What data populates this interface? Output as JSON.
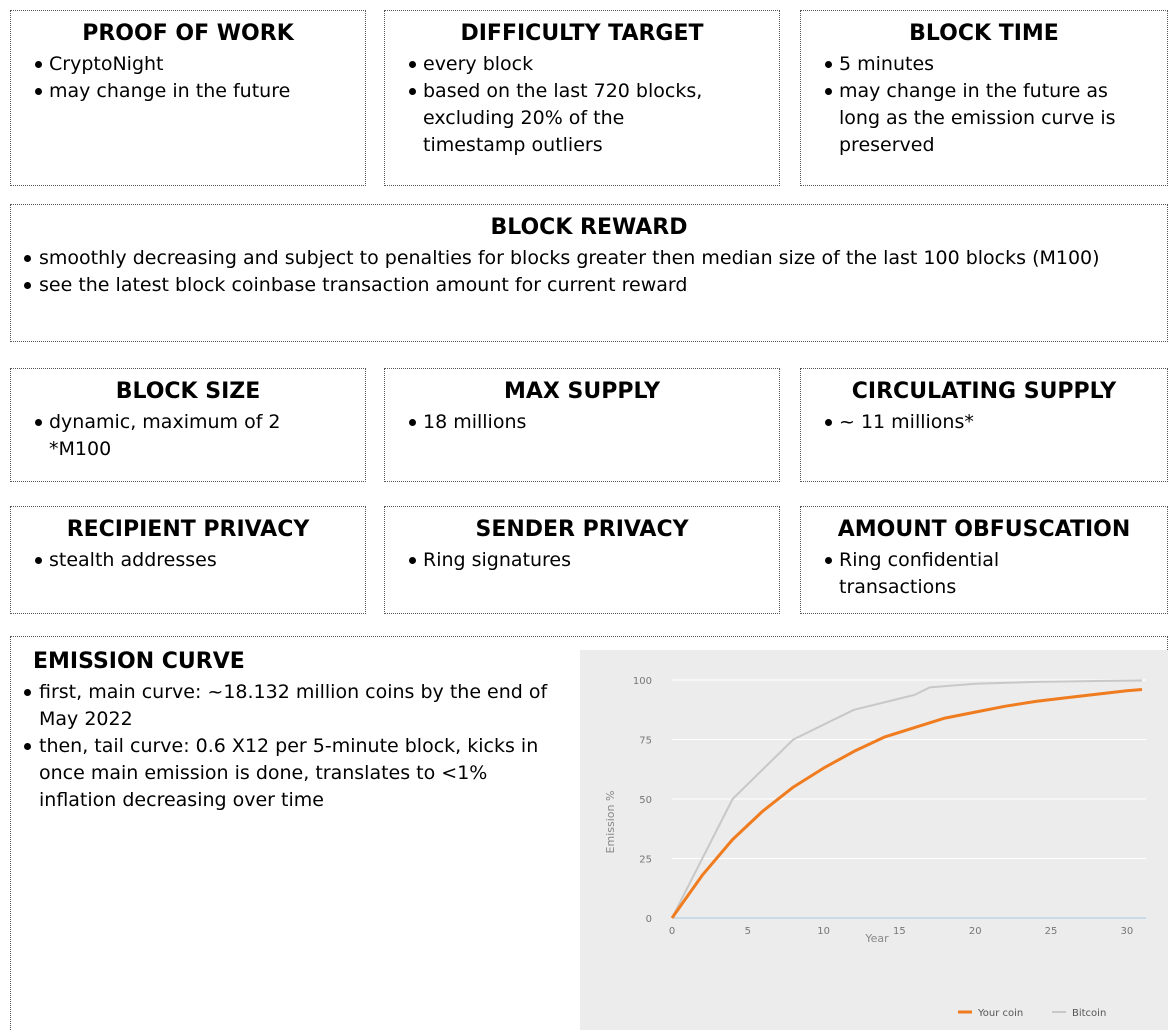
{
  "row1": [
    {
      "title": "PROOF OF WORK",
      "items": [
        "CryptoNight",
        "may change in the future"
      ]
    },
    {
      "title": "DIFFICULTY TARGET",
      "items": [
        "every block",
        "based on the last 720 blocks, excluding 20% of the timestamp outliers"
      ]
    },
    {
      "title": "BLOCK TIME",
      "items": [
        "5 minutes",
        "may change in the future as long as the emission curve is preserved"
      ]
    }
  ],
  "reward": {
    "title": "BLOCK REWARD",
    "items": [
      "smoothly decreasing and subject to penalties for blocks greater then median size of the last 100 blocks (M100)",
      "see the latest block coinbase transaction amount for current reward"
    ]
  },
  "row3": [
    {
      "title": "BLOCK SIZE",
      "items": [
        "dynamic, maximum of 2 *M100"
      ]
    },
    {
      "title": "MAX SUPPLY",
      "items": [
        "18 millions"
      ]
    },
    {
      "title": "CIRCULATING SUPPLY",
      "items": [
        "~ 11 millions*"
      ]
    }
  ],
  "row4": [
    {
      "title": "RECIPIENT PRIVACY",
      "items": [
        "stealth addresses"
      ]
    },
    {
      "title": "SENDER PRIVACY",
      "items": [
        "Ring signatures"
      ]
    },
    {
      "title": "AMOUNT OBFUSCATION",
      "items": [
        "Ring confidential transactions"
      ]
    }
  ],
  "emission": {
    "title": "EMISSION CURVE",
    "items": [
      "first, main curve: ~18.132 million coins by the end of May 2022",
      "then, tail curve: 0.6 X12 per 5-minute block, kicks in once main emission is done, translates to <1%  inflation decreasing over time"
    ]
  },
  "chart_data": {
    "type": "line",
    "xlabel": "Year",
    "ylabel": "Emission %",
    "xlim": [
      0,
      31
    ],
    "ylim": [
      0,
      100
    ],
    "xticks": [
      0,
      5,
      10,
      15,
      20,
      25,
      30
    ],
    "yticks": [
      0,
      25,
      50,
      75,
      100
    ],
    "grid": true,
    "legend": "bottom-right",
    "series": [
      {
        "name": "Your coin",
        "color": "#f07c20",
        "x": [
          0,
          2,
          4,
          6,
          8,
          10,
          12,
          14,
          16,
          18,
          20,
          22,
          24,
          26,
          28,
          30,
          31
        ],
        "y": [
          0,
          18,
          33,
          45,
          55,
          63,
          70,
          76,
          80,
          84,
          86.5,
          89,
          91,
          92.5,
          94,
          95.5,
          96
        ]
      },
      {
        "name": "Bitcoin",
        "color": "#c8c8c8",
        "x": [
          0,
          4,
          8,
          12,
          16,
          17,
          20,
          24,
          28,
          31
        ],
        "y": [
          0,
          50,
          75,
          87.5,
          93.75,
          96.9,
          98.4,
          99.2,
          99.6,
          99.8
        ]
      }
    ]
  }
}
